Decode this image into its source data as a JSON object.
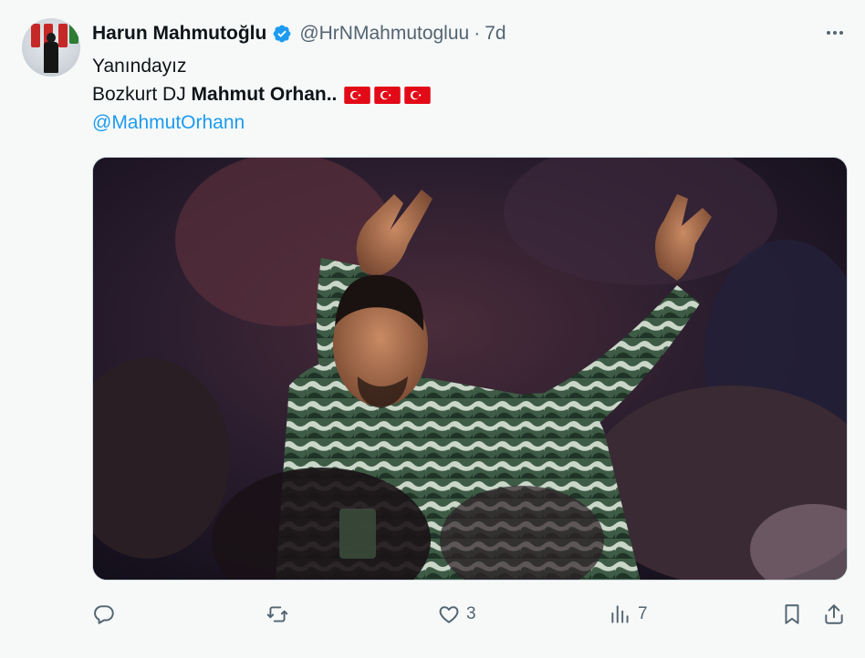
{
  "tweet": {
    "author_name": "Harun Mahmutoğlu",
    "handle": "@HrNMahmutogluu",
    "separator": "·",
    "time": "7d",
    "line1": "Yanındayız",
    "line2_prefix": "Bozkurt DJ ",
    "line2_bold": "Mahmut Orhan..",
    "flag_count": 3,
    "mention": "@MahmutOrhann"
  },
  "actions": {
    "reply_count": "",
    "retweet_count": "",
    "like_count": "3",
    "views_count": "7"
  },
  "colors": {
    "accent": "#1d9bf0",
    "muted": "#536471",
    "flag_red": "#e30a17"
  },
  "icons": [
    "verified-badge-icon",
    "more-options-icon",
    "turkish-flag-icon",
    "reply-icon",
    "retweet-icon",
    "like-icon",
    "views-icon",
    "bookmark-icon",
    "share-icon"
  ]
}
